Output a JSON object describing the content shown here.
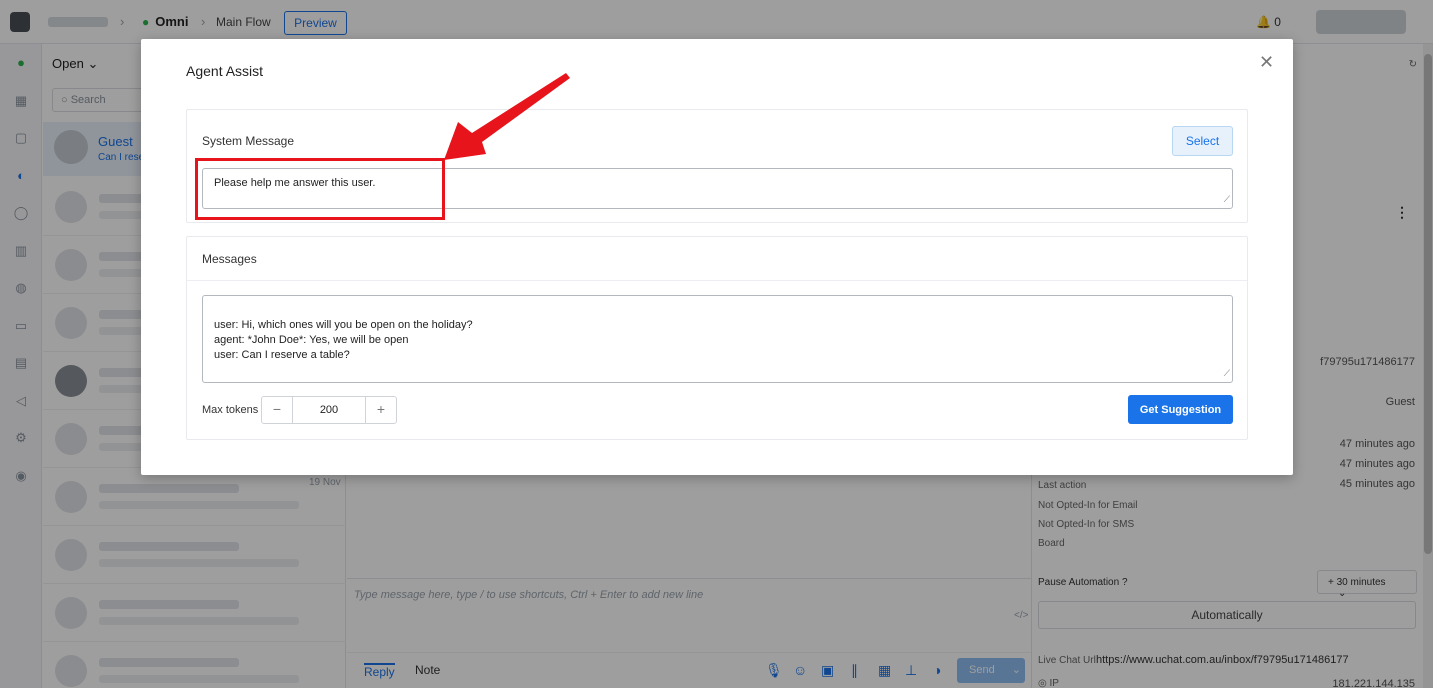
{
  "topbar": {
    "app_name": "Omni",
    "flow": "Main Flow",
    "preview_label": "Preview",
    "notifications": "0"
  },
  "sidebar": {
    "filter": "Open",
    "search_placeholder": "Search",
    "active_conversation": {
      "name": "Guest",
      "preview": "Can I rese"
    },
    "date": "19 Nov"
  },
  "composer": {
    "placeholder": "Type message here, type / to use shortcuts, Ctrl + Enter to add new line",
    "code_toggle": "</>",
    "tab_reply": "Reply",
    "tab_note": "Note",
    "send_label": "Send"
  },
  "details": {
    "user_id": "f79795u171486177",
    "name": "Guest",
    "time1": "47 minutes ago",
    "time2": "47 minutes ago",
    "last_action_label": "Last action",
    "last_action_value": "45 minutes ago",
    "email_optin": "Not Opted-In for Email",
    "sms_optin": "Not Opted-In for SMS",
    "board": "Board",
    "pause_label": "Pause Automation",
    "pause_value": "+ 30 minutes",
    "automatically": "Automatically",
    "live_chat_label": "Live Chat Url",
    "live_chat_url": "https://www.uchat.com.au/inbox/f79795u171486177",
    "ip_label": "IP",
    "ip_value": "181.221.144.135"
  },
  "modal": {
    "title": "Agent Assist",
    "system_message_label": "System Message",
    "select_label": "Select",
    "system_message_value": "Please help me answer this user.",
    "messages_label": "Messages",
    "messages_value": "user: Hi, which ones will you be open on the holiday?\nagent: *John Doe*: Yes, we will be open\nuser: Can I reserve a table?",
    "max_tokens_label": "Max tokens",
    "max_tokens_value": "200",
    "get_suggestion_label": "Get Suggestion"
  },
  "colors": {
    "accent": "#1a73e8",
    "annotation": "#e8141b"
  }
}
